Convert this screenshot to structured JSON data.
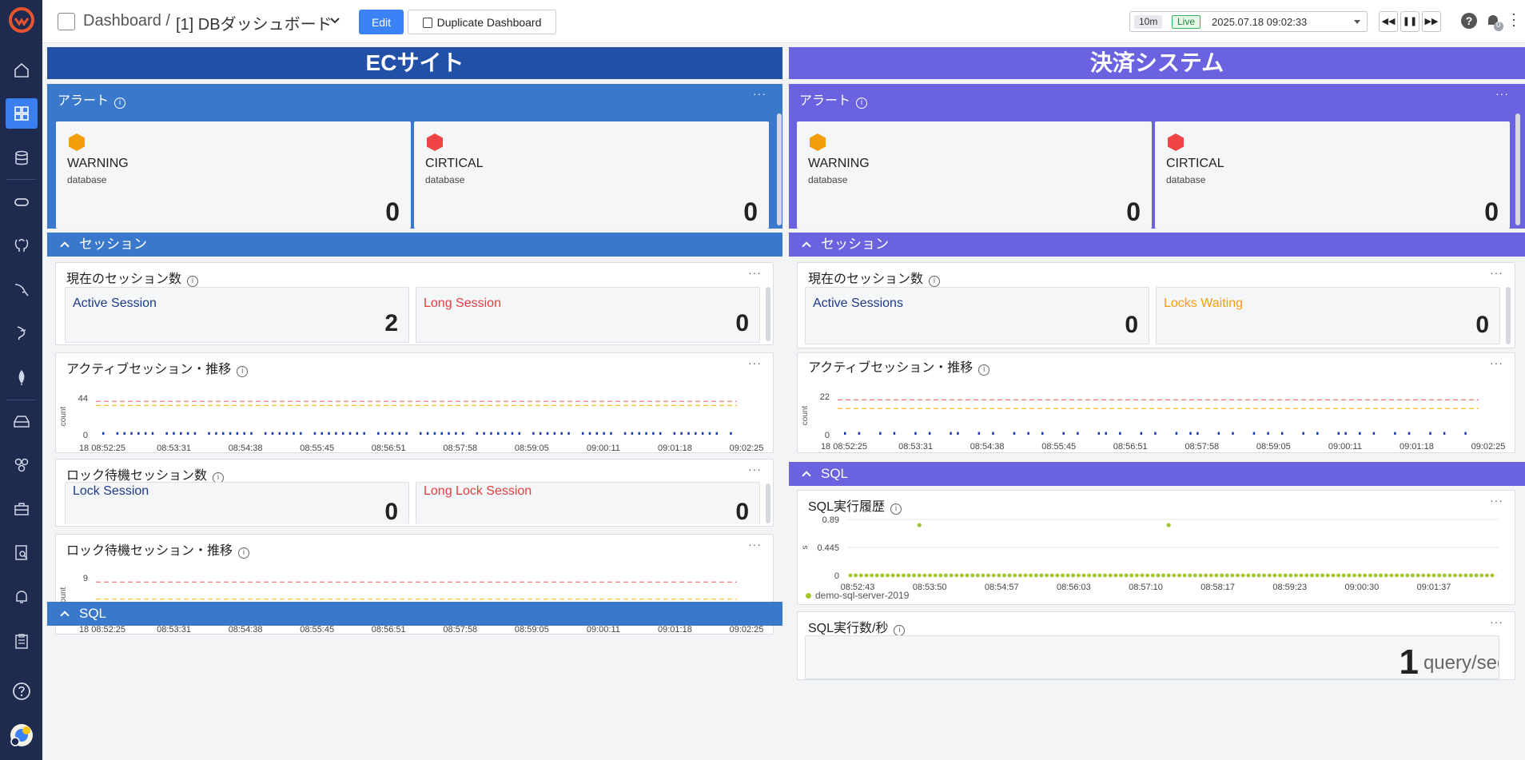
{
  "topbar": {
    "crumb": "Dashboard /",
    "title": "[1] DBダッシュボード",
    "edit_label": "Edit",
    "duplicate_label": "Duplicate Dashboard",
    "time_range": "10m",
    "live_label": "Live",
    "timestamp": "2025.07.18 09:02:33",
    "notification_count": "0",
    "help_label": "?"
  },
  "left": {
    "banner": "ECサイト",
    "alert": {
      "title": "アラート",
      "cards": [
        {
          "level": "WARNING",
          "sub": "database",
          "value": "0",
          "color": "#f59e0b"
        },
        {
          "level": "CIRTICAL",
          "sub": "database",
          "value": "0",
          "color": "#ef4444"
        }
      ]
    },
    "session_group": "セッション",
    "current_sessions": {
      "title": "現在のセッション数",
      "cards": [
        {
          "label": "Active Session",
          "value": "2",
          "color": "#1e3a8a"
        },
        {
          "label": "Long Session",
          "value": "0",
          "color": "#e53e3e"
        }
      ]
    },
    "active_trend": {
      "title": "アクティブセッション・推移",
      "chart_data": {
        "type": "bar",
        "ylabel": "count",
        "y_ticks": [
          "44",
          "0"
        ],
        "x_ticks": [
          "18 08:52:25",
          "08:53:31",
          "08:54:38",
          "08:55:45",
          "08:56:51",
          "08:57:58",
          "08:59:05",
          "09:00:11",
          "09:01:18",
          "09:02:25"
        ],
        "ylim": [
          0,
          44
        ],
        "thresholds": [
          {
            "value": 40,
            "color": "#f87171"
          },
          {
            "value": 35,
            "color": "#fbbf24"
          }
        ],
        "bar_color": "#1e40af",
        "values": [
          1,
          0,
          1,
          1,
          1,
          1,
          1,
          1,
          0,
          1,
          1,
          1,
          1,
          1,
          0,
          1,
          1,
          1,
          1,
          1,
          1,
          1,
          0,
          1,
          1,
          1,
          1,
          1,
          1,
          0,
          1,
          1,
          1,
          1,
          1,
          1,
          1,
          1,
          0,
          1,
          1,
          1,
          1,
          1,
          0,
          1,
          1,
          1,
          1,
          1,
          1,
          1,
          0,
          1,
          1,
          1,
          1,
          1,
          1,
          1,
          0,
          1,
          1,
          1,
          1,
          1,
          1,
          0,
          1,
          1,
          1,
          1,
          1,
          0,
          1,
          1,
          1,
          1,
          1,
          1,
          0,
          1,
          1,
          1,
          1,
          1,
          1,
          1,
          0,
          1
        ]
      }
    },
    "lock_sessions": {
      "title": "ロック待機セッション数",
      "cards": [
        {
          "label": "Lock Session",
          "value": "0",
          "color": "#1e3a8a"
        },
        {
          "label": "Long Lock Session",
          "value": "0",
          "color": "#e53e3e"
        }
      ]
    },
    "lock_trend": {
      "title": "ロック待機セッション・推移",
      "chart_data": {
        "type": "bar",
        "ylabel": "count",
        "y_ticks": [
          "9",
          "0"
        ],
        "x_ticks": [
          "18 08:52:25",
          "08:53:31",
          "08:54:38",
          "08:55:45",
          "08:56:51",
          "08:57:58",
          "08:59:05",
          "09:00:11",
          "09:01:18",
          "09:02:25"
        ],
        "ylim": [
          0,
          9
        ],
        "thresholds": [
          {
            "value": 8,
            "color": "#f87171"
          },
          {
            "value": 4,
            "color": "#fbbf24"
          }
        ],
        "values": []
      }
    },
    "sql_group": "SQL"
  },
  "right": {
    "banner": "決済システム",
    "alert": {
      "title": "アラート",
      "cards": [
        {
          "level": "WARNING",
          "sub": "database",
          "value": "0",
          "color": "#f59e0b"
        },
        {
          "level": "CIRTICAL",
          "sub": "database",
          "value": "0",
          "color": "#ef4444"
        }
      ]
    },
    "session_group": "セッション",
    "current_sessions": {
      "title": "現在のセッション数",
      "cards": [
        {
          "label": "Active Sessions",
          "value": "0",
          "color": "#1e3a8a"
        },
        {
          "label": "Locks Waiting",
          "value": "0",
          "color": "#f59e0b"
        }
      ]
    },
    "active_trend": {
      "title": "アクティブセッション・推移",
      "chart_data": {
        "type": "bar",
        "ylabel": "count",
        "y_ticks": [
          "22",
          "0"
        ],
        "x_ticks": [
          "18 08:52:25",
          "08:53:31",
          "08:54:38",
          "08:55:45",
          "08:56:51",
          "08:57:58",
          "08:59:05",
          "09:00:11",
          "09:01:18",
          "09:02:25"
        ],
        "ylim": [
          0,
          22
        ],
        "thresholds": [
          {
            "value": 20,
            "color": "#f87171"
          },
          {
            "value": 15,
            "color": "#fbbf24"
          }
        ],
        "bar_color": "#1e40af",
        "values": [
          1,
          0,
          1,
          0,
          0,
          1,
          0,
          1,
          0,
          0,
          1,
          0,
          1,
          0,
          0,
          1,
          1,
          0,
          0,
          1,
          0,
          1,
          0,
          0,
          1,
          0,
          1,
          0,
          1,
          0,
          0,
          1,
          0,
          1,
          0,
          0,
          1,
          1,
          0,
          1,
          0,
          0,
          1,
          0,
          1,
          0,
          0,
          1,
          0,
          1,
          1,
          0,
          0,
          1,
          0,
          1,
          0,
          0,
          1,
          0,
          1,
          0,
          1,
          0,
          0,
          1,
          0,
          1,
          0,
          0,
          1,
          1,
          0,
          1,
          0,
          1,
          0,
          0,
          1,
          0,
          1,
          0,
          0,
          1,
          0,
          1,
          0,
          0,
          1,
          0
        ]
      }
    },
    "sql_group": "SQL",
    "sql_history": {
      "title": "SQL実行履歴",
      "legend": "demo-sql-server-2019",
      "chart_data": {
        "type": "scatter",
        "ylabel": "s",
        "y_ticks": [
          "0.89",
          "0.445",
          "0"
        ],
        "x_ticks": [
          "08:52:43",
          "08:53:50",
          "08:54:57",
          "08:56:03",
          "08:57:10",
          "08:58:17",
          "08:59:23",
          "09:00:30",
          "09:01:37"
        ],
        "ylim": [
          0,
          0.89
        ],
        "color": "#a3c72e",
        "values": [
          0,
          0,
          0,
          0,
          0,
          0,
          0,
          0,
          0,
          0,
          0,
          0,
          0,
          0,
          0,
          0,
          0,
          0,
          0,
          0,
          0,
          0,
          0,
          0,
          0,
          0,
          0,
          0,
          0,
          0,
          0,
          0,
          0,
          0,
          0,
          0,
          0,
          0,
          0,
          0,
          0,
          0,
          0,
          0,
          0,
          0,
          0,
          0,
          0,
          0,
          0,
          0,
          0,
          0,
          0,
          0,
          0,
          0,
          0,
          0,
          0,
          0,
          0,
          0,
          0,
          0,
          0,
          0,
          0,
          0,
          0,
          0,
          0,
          0,
          0,
          0,
          0,
          0,
          0,
          0,
          0,
          0,
          0,
          0,
          0,
          0,
          0,
          0,
          0,
          0,
          0,
          0,
          0,
          0,
          0,
          0,
          0,
          0,
          0,
          0,
          0,
          0,
          0,
          0,
          0,
          0,
          0,
          0,
          0,
          0,
          0,
          0,
          0,
          0,
          0,
          0,
          0,
          0,
          0,
          0,
          0,
          0
        ],
        "outliers": [
          {
            "index": 13,
            "value": 0.8
          },
          {
            "index": 60,
            "value": 0.8
          }
        ]
      }
    },
    "sql_rate": {
      "title": "SQL実行数/秒",
      "value": "1",
      "unit": "query/sec"
    }
  }
}
